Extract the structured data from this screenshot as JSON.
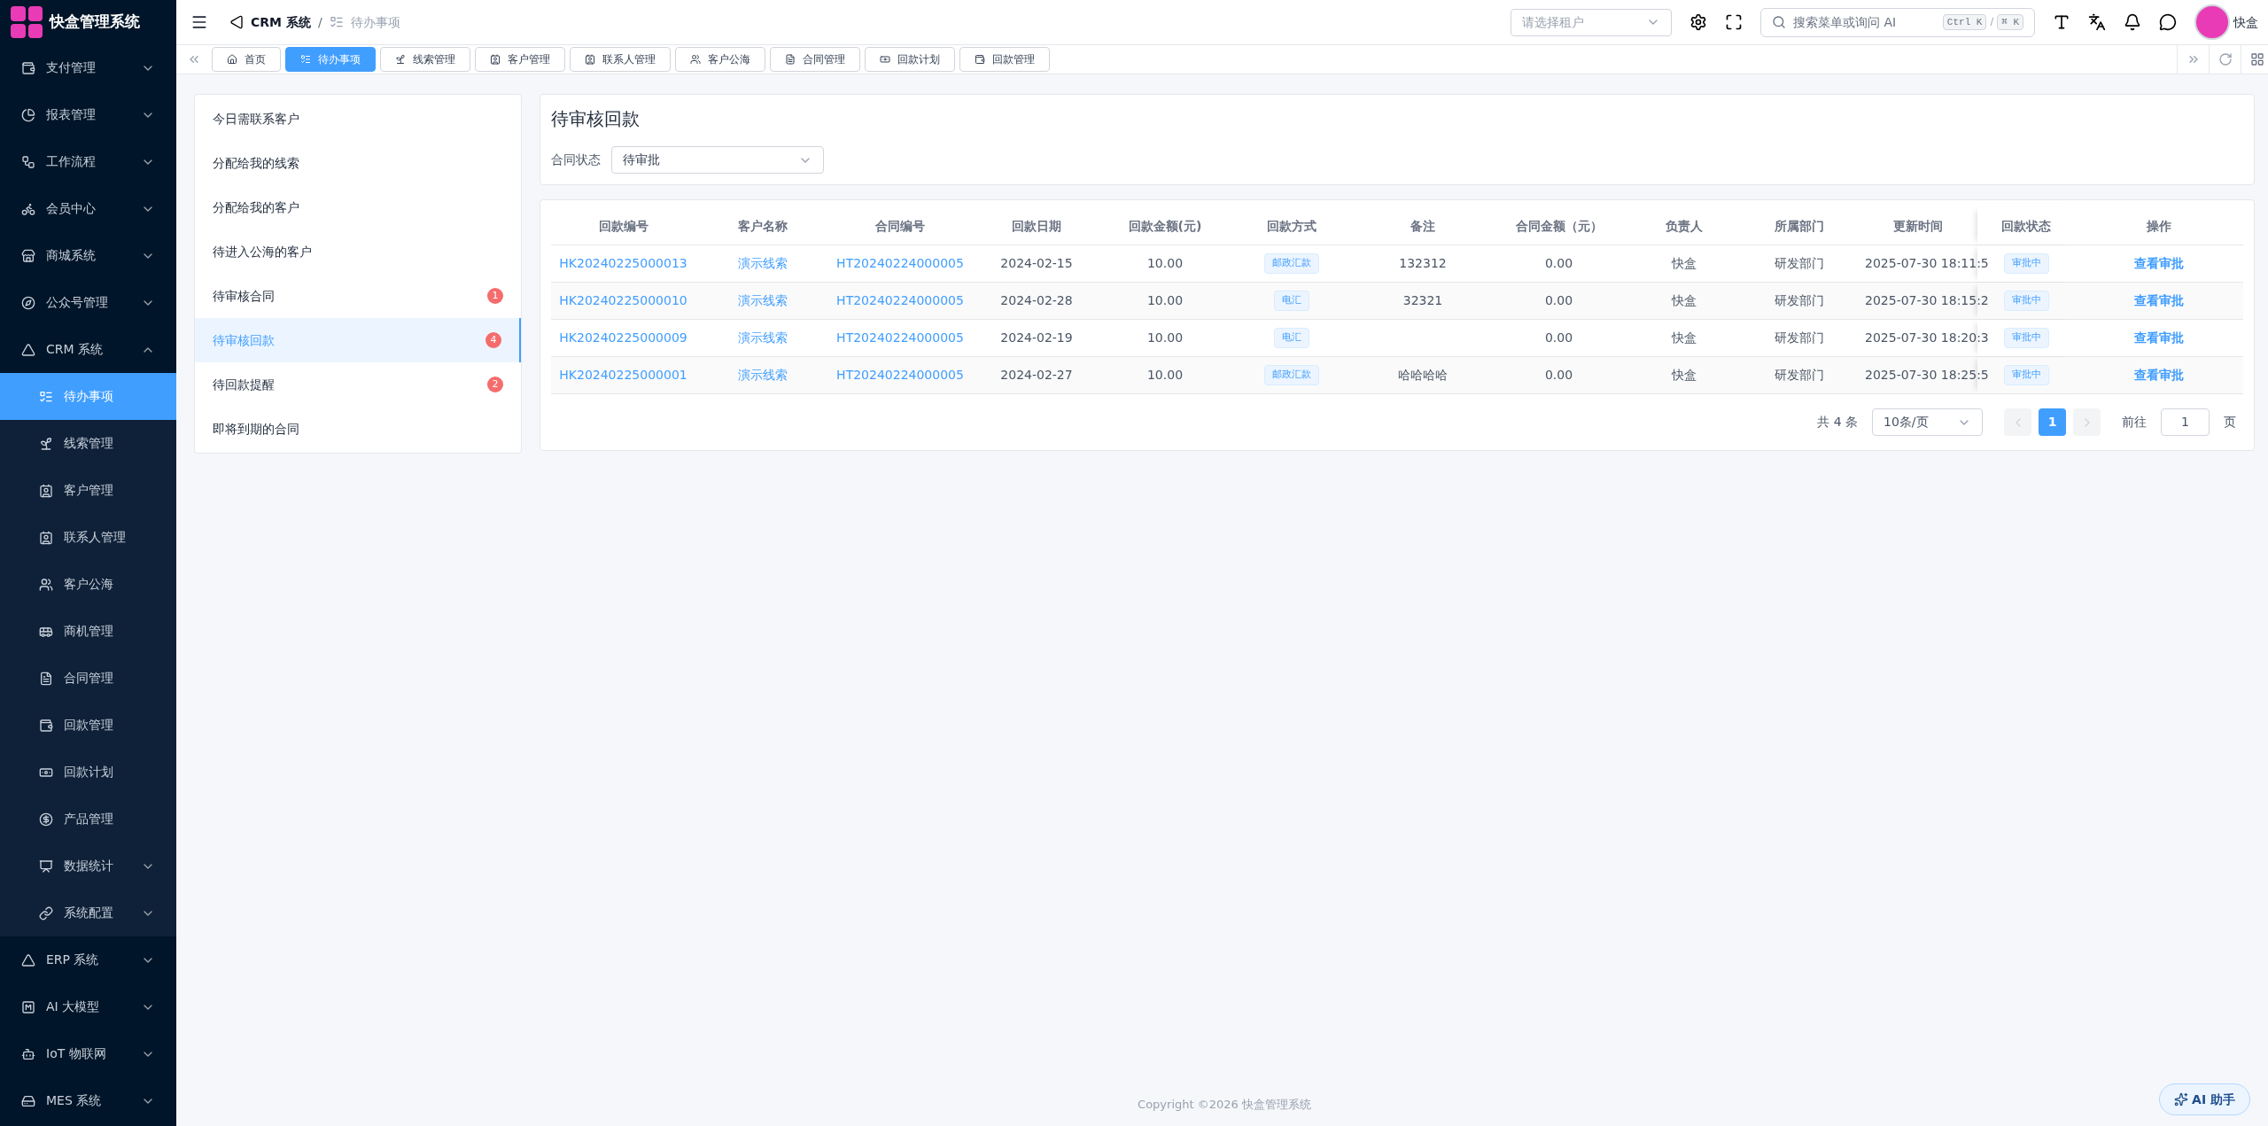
{
  "sidebar": {
    "app_name": "快盒管理系统",
    "items": [
      {
        "label": "支付管理",
        "expanded": false
      },
      {
        "label": "报表管理",
        "expanded": false
      },
      {
        "label": "工作流程",
        "expanded": false
      },
      {
        "label": "会员中心",
        "expanded": false
      },
      {
        "label": "商城系统",
        "expanded": false
      },
      {
        "label": "公众号管理",
        "expanded": false
      },
      {
        "label": "CRM 系统",
        "expanded": true,
        "children": [
          {
            "label": "待办事项",
            "selected": true
          },
          {
            "label": "线索管理",
            "selected": false
          },
          {
            "label": "客户管理",
            "selected": false
          },
          {
            "label": "联系人管理",
            "selected": false
          },
          {
            "label": "客户公海",
            "selected": false
          },
          {
            "label": "商机管理",
            "selected": false
          },
          {
            "label": "合同管理",
            "selected": false
          },
          {
            "label": "回款管理",
            "selected": false
          },
          {
            "label": "回款计划",
            "selected": false
          },
          {
            "label": "产品管理",
            "selected": false
          },
          {
            "label": "数据统计",
            "selected": false,
            "expanded": false
          },
          {
            "label": "系统配置",
            "selected": false,
            "expanded": false
          }
        ]
      },
      {
        "label": "ERP 系统",
        "expanded": false
      },
      {
        "label": "AI 大模型",
        "expanded": false
      },
      {
        "label": "IoT 物联网",
        "expanded": false
      },
      {
        "label": "MES 系统",
        "expanded": false
      }
    ]
  },
  "header": {
    "breadcrumb": [
      "CRM 系统",
      "待办事项"
    ],
    "breadcrumb_separator": "/",
    "tenant_select": {
      "placeholder": "请选择租户"
    },
    "search": {
      "placeholder": "搜索菜单或询问 AI",
      "shortcuts": [
        "Ctrl K",
        "/",
        "⌘ K"
      ]
    },
    "user_name": "快盒"
  },
  "tabs": [
    {
      "label": "首页",
      "selected": false
    },
    {
      "label": "待办事项",
      "selected": true
    },
    {
      "label": "线索管理",
      "selected": false
    },
    {
      "label": "客户管理",
      "selected": false
    },
    {
      "label": "联系人管理",
      "selected": false
    },
    {
      "label": "客户公海",
      "selected": false
    },
    {
      "label": "合同管理",
      "selected": false
    },
    {
      "label": "回款计划",
      "selected": false
    },
    {
      "label": "回款管理",
      "selected": false
    }
  ],
  "todo_menu": [
    {
      "label": "今日需联系客户",
      "selected": false
    },
    {
      "label": "分配给我的线索",
      "selected": false
    },
    {
      "label": "分配给我的客户",
      "selected": false
    },
    {
      "label": "待进入公海的客户",
      "selected": false
    },
    {
      "label": "待审核合同",
      "selected": false,
      "badge": "1"
    },
    {
      "label": "待审核回款",
      "selected": true,
      "badge": "4"
    },
    {
      "label": "待回款提醒",
      "selected": false,
      "badge": "2"
    },
    {
      "label": "即将到期的合同",
      "selected": false
    }
  ],
  "panel": {
    "title": "待审核回款",
    "filter": {
      "label": "合同状态",
      "value": "待审批"
    }
  },
  "table": {
    "columns": [
      "回款编号",
      "客户名称",
      "合同编号",
      "回款日期",
      "回款金额(元)",
      "回款方式",
      "备注",
      "合同金额（元）",
      "负责人",
      "所属部门",
      "更新时间",
      "回款状态",
      "操作"
    ],
    "rows": [
      [
        "HK20240225000013",
        "演示线索",
        "HT20240224000005",
        "2024-02-15",
        "10.00",
        "邮政汇款",
        "132312",
        "0.00",
        "快盒",
        "研发部门",
        "2025-07-30 18:11:5",
        "审批中",
        "查看审批"
      ],
      [
        "HK20240225000010",
        "演示线索",
        "HT20240224000005",
        "2024-02-28",
        "10.00",
        "电汇",
        "32321",
        "0.00",
        "快盒",
        "研发部门",
        "2025-07-30 18:15:2",
        "审批中",
        "查看审批"
      ],
      [
        "HK20240225000009",
        "演示线索",
        "HT20240224000005",
        "2024-02-19",
        "10.00",
        "电汇",
        "",
        "0.00",
        "快盒",
        "研发部门",
        "2025-07-30 18:20:3",
        "审批中",
        "查看审批"
      ],
      [
        "HK20240225000001",
        "演示线索",
        "HT20240224000005",
        "2024-02-27",
        "10.00",
        "邮政汇款",
        "哈哈哈哈",
        "0.00",
        "快盒",
        "研发部门",
        "2025-07-30 18:25:5",
        "审批中",
        "查看审批"
      ]
    ]
  },
  "pagination": {
    "total": "共 4 条",
    "page_size": "10条/页",
    "pages": [
      {
        "label": "1",
        "selected": true
      }
    ],
    "goto_label": "前往",
    "goto_value": "1",
    "goto_suffix": "页"
  },
  "footer": "Copyright ©2026 快盒管理系统",
  "ai_button": "AI 助手"
}
